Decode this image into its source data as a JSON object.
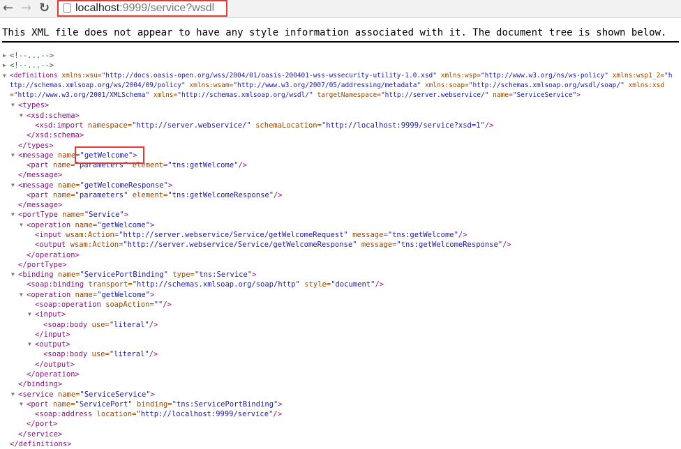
{
  "browser": {
    "back_icon": "arrow-left-icon",
    "forward_icon": "arrow-right-icon",
    "reload_icon": "reload-icon",
    "url_host": "localhost",
    "url_rest": ":9999/service?wsdl"
  },
  "notice": "This XML file does not appear to have any style information associated with it. The document tree is shown below.",
  "colors": {
    "tag": "#881280",
    "attr": "#994500",
    "value": "#1a1aa6",
    "comment": "#236e25",
    "highlight": "#e53935"
  },
  "lines": [
    {
      "d": 0,
      "arrow": "right",
      "s": [
        [
          "c",
          "<!--...-->"
        ]
      ]
    },
    {
      "d": 0,
      "arrow": "right",
      "s": [
        [
          "c",
          "<!--...-->"
        ]
      ]
    },
    {
      "d": 0,
      "arrow": "down",
      "s": [
        [
          "t",
          "<definitions"
        ],
        [
          "a",
          " xmlns:wsu="
        ],
        [
          "v",
          "\"http://docs.oasis-open.org/wss/2004/01/oasis-200401-wss-wssecurity-utility-1.0.xsd\""
        ],
        [
          "a",
          " xmlns:wsp="
        ],
        [
          "v",
          "\"http://www.w3.org/ns/ws-policy\""
        ]
      ]
    },
    {
      "d": 0,
      "wrap": true,
      "s": [
        [
          "a",
          "xmlns:wsp1_2="
        ],
        [
          "v",
          "\"http://schemas.xmlsoap.org/ws/2004/09/policy\""
        ],
        [
          "a",
          " xmlns:wsam="
        ],
        [
          "v",
          "\"http://www.w3.org/2007/05/addressing/metadata\""
        ],
        [
          "a",
          " xmlns:soap="
        ],
        [
          "v",
          "\"http://schemas.xmlsoap.org/wsdl/soap/\""
        ]
      ]
    },
    {
      "d": 0,
      "wrap": true,
      "s": [
        [
          "a",
          "xmlns:xsd="
        ],
        [
          "v",
          "\"http://www.w3.org/2001/XMLSchema\""
        ],
        [
          "a",
          " xmlns="
        ],
        [
          "v",
          "\"http://schemas.xmlsoap.org/wsdl/\""
        ],
        [
          "a",
          " targetNamespace="
        ],
        [
          "v",
          "\"http://server.webservice/\""
        ],
        [
          "a",
          " name="
        ],
        [
          "v",
          "\"ServiceService\""
        ],
        [
          "t",
          ">"
        ]
      ]
    },
    {
      "d": 1,
      "arrow": "down",
      "s": [
        [
          "t",
          "<types>"
        ]
      ]
    },
    {
      "d": 2,
      "arrow": "down",
      "s": [
        [
          "t",
          "<xsd:schema>"
        ]
      ]
    },
    {
      "d": 3,
      "s": [
        [
          "t",
          "<xsd:import"
        ],
        [
          "a",
          " namespace="
        ],
        [
          "v",
          "\"http://server.webservice/\""
        ],
        [
          "a",
          " schemaLocation="
        ],
        [
          "v",
          "\"http://localhost:9999/service?xsd=1\""
        ],
        [
          "t",
          "/>"
        ]
      ]
    },
    {
      "d": 2,
      "s": [
        [
          "t",
          "</xsd:schema>"
        ]
      ]
    },
    {
      "d": 1,
      "s": [
        [
          "t",
          "</types>"
        ]
      ]
    },
    {
      "d": 1,
      "arrow": "down",
      "s": [
        [
          "t",
          "<message"
        ],
        [
          "a",
          " name="
        ],
        [
          "v",
          "\"getWelcome\""
        ],
        [
          "t",
          ">"
        ]
      ]
    },
    {
      "d": 2,
      "s": [
        [
          "t",
          "<part"
        ],
        [
          "a",
          " name="
        ],
        [
          "v",
          "\"parameters\""
        ],
        [
          "a",
          " element="
        ],
        [
          "v",
          "\"tns:getWelcome\""
        ],
        [
          "t",
          "/>"
        ]
      ]
    },
    {
      "d": 1,
      "s": [
        [
          "t",
          "</message>"
        ]
      ]
    },
    {
      "d": 1,
      "arrow": "down",
      "s": [
        [
          "t",
          "<message"
        ],
        [
          "a",
          " name="
        ],
        [
          "v",
          "\"getWelcomeResponse\""
        ],
        [
          "t",
          ">"
        ]
      ]
    },
    {
      "d": 2,
      "s": [
        [
          "t",
          "<part"
        ],
        [
          "a",
          " name="
        ],
        [
          "v",
          "\"parameters\""
        ],
        [
          "a",
          " element="
        ],
        [
          "v",
          "\"tns:getWelcomeResponse\""
        ],
        [
          "t",
          "/>"
        ]
      ]
    },
    {
      "d": 1,
      "s": [
        [
          "t",
          "</message>"
        ]
      ]
    },
    {
      "d": 1,
      "arrow": "down",
      "s": [
        [
          "t",
          "<portType"
        ],
        [
          "a",
          " name="
        ],
        [
          "v",
          "\"Service\""
        ],
        [
          "t",
          ">"
        ]
      ]
    },
    {
      "d": 2,
      "arrow": "down",
      "s": [
        [
          "t",
          "<operation"
        ],
        [
          "a",
          " name="
        ],
        [
          "v",
          "\"getWelcome\""
        ],
        [
          "t",
          ">"
        ]
      ]
    },
    {
      "d": 3,
      "s": [
        [
          "t",
          "<input"
        ],
        [
          "a",
          " wsam:Action="
        ],
        [
          "v",
          "\"http://server.webservice/Service/getWelcomeRequest\""
        ],
        [
          "a",
          " message="
        ],
        [
          "v",
          "\"tns:getWelcome\""
        ],
        [
          "t",
          "/>"
        ]
      ]
    },
    {
      "d": 3,
      "s": [
        [
          "t",
          "<output"
        ],
        [
          "a",
          " wsam:Action="
        ],
        [
          "v",
          "\"http://server.webservice/Service/getWelcomeResponse\""
        ],
        [
          "a",
          " message="
        ],
        [
          "v",
          "\"tns:getWelcomeResponse\""
        ],
        [
          "t",
          "/>"
        ]
      ]
    },
    {
      "d": 2,
      "s": [
        [
          "t",
          "</operation>"
        ]
      ]
    },
    {
      "d": 1,
      "s": [
        [
          "t",
          "</portType>"
        ]
      ]
    },
    {
      "d": 1,
      "arrow": "down",
      "s": [
        [
          "t",
          "<binding"
        ],
        [
          "a",
          " name="
        ],
        [
          "v",
          "\"ServicePortBinding\""
        ],
        [
          "a",
          " type="
        ],
        [
          "v",
          "\"tns:Service\""
        ],
        [
          "t",
          ">"
        ]
      ]
    },
    {
      "d": 2,
      "s": [
        [
          "t",
          "<soap:binding"
        ],
        [
          "a",
          " transport="
        ],
        [
          "v",
          "\"http://schemas.xmlsoap.org/soap/http\""
        ],
        [
          "a",
          " style="
        ],
        [
          "v",
          "\"document\""
        ],
        [
          "t",
          "/>"
        ]
      ]
    },
    {
      "d": 2,
      "arrow": "down",
      "s": [
        [
          "t",
          "<operation"
        ],
        [
          "a",
          " name="
        ],
        [
          "v",
          "\"getWelcome\""
        ],
        [
          "t",
          ">"
        ]
      ]
    },
    {
      "d": 3,
      "s": [
        [
          "t",
          "<soap:operation"
        ],
        [
          "a",
          " soapAction="
        ],
        [
          "v",
          "\"\""
        ],
        [
          "t",
          "/>"
        ]
      ]
    },
    {
      "d": 3,
      "arrow": "down",
      "s": [
        [
          "t",
          "<input>"
        ]
      ]
    },
    {
      "d": 4,
      "s": [
        [
          "t",
          "<soap:body"
        ],
        [
          "a",
          " use="
        ],
        [
          "v",
          "\"literal\""
        ],
        [
          "t",
          "/>"
        ]
      ]
    },
    {
      "d": 3,
      "s": [
        [
          "t",
          "</input>"
        ]
      ]
    },
    {
      "d": 3,
      "arrow": "down",
      "s": [
        [
          "t",
          "<output>"
        ]
      ]
    },
    {
      "d": 4,
      "s": [
        [
          "t",
          "<soap:body"
        ],
        [
          "a",
          " use="
        ],
        [
          "v",
          "\"literal\""
        ],
        [
          "t",
          "/>"
        ]
      ]
    },
    {
      "d": 3,
      "s": [
        [
          "t",
          "</output>"
        ]
      ]
    },
    {
      "d": 2,
      "s": [
        [
          "t",
          "</operation>"
        ]
      ]
    },
    {
      "d": 1,
      "s": [
        [
          "t",
          "</binding>"
        ]
      ]
    },
    {
      "d": 1,
      "arrow": "down",
      "s": [
        [
          "t",
          "<service"
        ],
        [
          "a",
          " name="
        ],
        [
          "v",
          "\"ServiceService\""
        ],
        [
          "t",
          ">"
        ]
      ]
    },
    {
      "d": 2,
      "arrow": "down",
      "s": [
        [
          "t",
          "<port"
        ],
        [
          "a",
          " name="
        ],
        [
          "v",
          "\"ServicePort\""
        ],
        [
          "a",
          " binding="
        ],
        [
          "v",
          "\"tns:ServicePortBinding\""
        ],
        [
          "t",
          ">"
        ]
      ]
    },
    {
      "d": 3,
      "s": [
        [
          "t",
          "<soap:address"
        ],
        [
          "a",
          " location="
        ],
        [
          "v",
          "\"http://localhost:9999/service\""
        ],
        [
          "t",
          "/>"
        ]
      ]
    },
    {
      "d": 2,
      "s": [
        [
          "t",
          "</port>"
        ]
      ]
    },
    {
      "d": 1,
      "s": [
        [
          "t",
          "</service>"
        ]
      ]
    },
    {
      "d": 0,
      "s": [
        [
          "t",
          "</definitions>"
        ]
      ]
    }
  ]
}
